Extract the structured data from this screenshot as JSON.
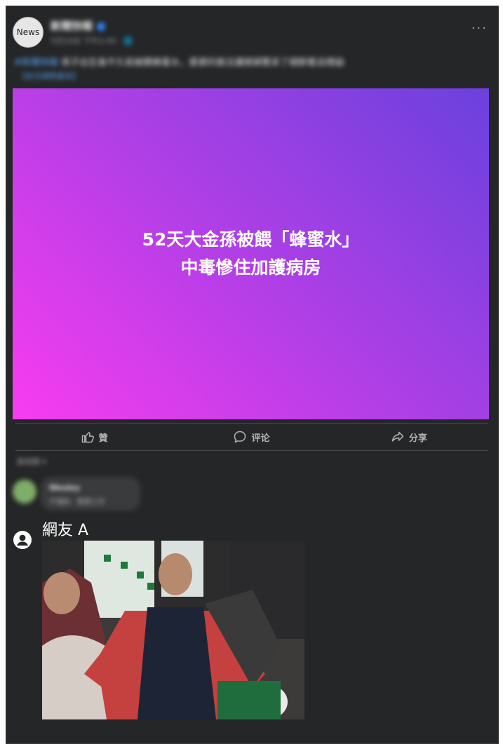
{
  "post": {
    "avatar_text": "News",
    "page_name": "新聞快報",
    "meta": "5月14日 下午2:44 · 🌐",
    "text_tag": "#新聞快報",
    "text": "孫子出生後不久就被餵蜂蜜水，婆婆的做法讓媳婦驚呆了細節看這裡😱",
    "sub_link": "【全文請見留言】",
    "more_icon": "more-dots-icon"
  },
  "hero": {
    "line1": "52天大金孫被餵「蜂蜜水」",
    "line2": "中毒慘住加護病房",
    "gradient_colors": [
      "#f83cf0",
      "#b13fe6",
      "#6a41dd"
    ]
  },
  "actions": {
    "like": "贊",
    "comment": "评论",
    "share": "分享"
  },
  "comments": {
    "sort_label": "最相關 ▾",
    "first": {
      "name": "Wesley",
      "text": "不懂耗 · 寶寶工作"
    },
    "second": {
      "name": "網友 A",
      "image_description": "disappointed-fan-meme"
    }
  },
  "colors": {
    "background": "#252627",
    "text_primary": "#ffffff",
    "text_secondary": "#b0b3b8",
    "link": "#5aa7ff"
  }
}
